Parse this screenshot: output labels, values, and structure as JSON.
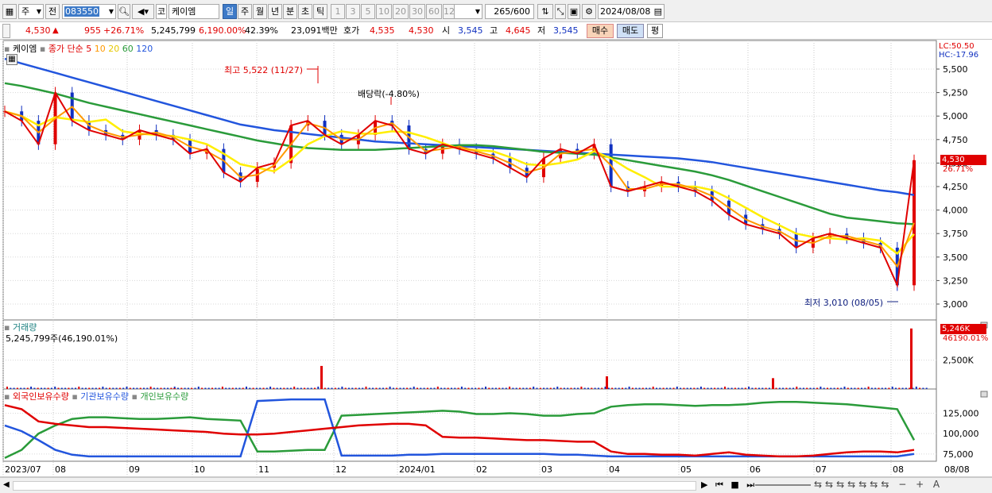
{
  "toolbar": {
    "market_mode": "주",
    "prev_label": "전",
    "stock_code": "083550",
    "market_tag": "코",
    "stock_name": "케이엠",
    "periods": [
      "일",
      "주",
      "월",
      "년",
      "분",
      "초",
      "틱"
    ],
    "active_period": "일",
    "intervals": [
      "1",
      "3",
      "5",
      "10",
      "20",
      "30",
      "60",
      "120"
    ],
    "count_value": "265",
    "count_total": "/600",
    "date": "2024/08/08"
  },
  "quote": {
    "price": "4,530",
    "change": "955",
    "change_pct": "+26.71%",
    "volume": "5,245,799",
    "volume_pct": "6,190.00%",
    "turnover": "42.39%",
    "amount": "23,091백만",
    "hoga_label": "호가",
    "ask": "4,535",
    "bid": "4,530",
    "open_label": "시",
    "open": "3,545",
    "high_label": "고",
    "high": "4,645",
    "low_label": "저",
    "low": "3,545",
    "buy_label": "매수",
    "sell_label": "매도",
    "eval_label": "평"
  },
  "price_panel": {
    "name": "케이엠",
    "legend_prefix": "종가 단순",
    "ma_labels": [
      "5",
      "10",
      "20",
      "60",
      "120"
    ],
    "ma_colors": [
      "#e00000",
      "#ff9900",
      "#ffee00",
      "#2a9b3a",
      "#2255dd"
    ],
    "lc": "LC:50.50",
    "hc": "HC:-17.96",
    "y_ticks": [
      "5,500",
      "5,250",
      "5,000",
      "4,750",
      "4,500",
      "4,250",
      "4,000",
      "3,750",
      "3,500",
      "3,250",
      "3,000"
    ],
    "current_price_tag": "4,530",
    "current_pct_tag": "26.71%",
    "high_annotation": "최고 5,522 (11/27)",
    "dividend_annotation": "배당락(-4.80%)",
    "low_annotation": "최저 3,010 (08/05)"
  },
  "volume_panel": {
    "name": "거래량",
    "info": "5,245,799주(46,190.01%)",
    "current_tag": "5,246K",
    "current_pct": "46190.01%",
    "y_tick": "2,500K"
  },
  "holding_panel": {
    "series": [
      {
        "name": "외국인보유수량",
        "color": "#e00000"
      },
      {
        "name": "기관보유수량",
        "color": "#2255dd"
      },
      {
        "name": "개인보유수량",
        "color": "#2a9b3a"
      }
    ],
    "y_ticks": [
      "125,000",
      "100,000",
      "75,000"
    ]
  },
  "x_axis": {
    "labels": [
      "2023/07",
      "08",
      "09",
      "10",
      "11",
      "12",
      "2024/01",
      "02",
      "03",
      "04",
      "05",
      "06",
      "07",
      "08"
    ],
    "right_label": "08/08"
  },
  "chart_data": {
    "type": "line",
    "price_range": [
      3000,
      5522
    ],
    "x_labels": [
      "2023/07",
      "08",
      "09",
      "10",
      "11",
      "12",
      "2024/01",
      "02",
      "03",
      "04",
      "05",
      "06",
      "07",
      "08"
    ],
    "close": [
      5050,
      4950,
      4700,
      5250,
      4950,
      4850,
      4800,
      4750,
      4850,
      4800,
      4750,
      4600,
      4650,
      4400,
      4300,
      4450,
      4500,
      4900,
      4950,
      4800,
      4700,
      4800,
      4950,
      4900,
      4650,
      4600,
      4700,
      4650,
      4600,
      4550,
      4450,
      4350,
      4550,
      4650,
      4600,
      4700,
      4250,
      4200,
      4250,
      4300,
      4250,
      4200,
      4100,
      3950,
      3850,
      3800,
      3750,
      3600,
      3700,
      3750,
      3700,
      3650,
      3600,
      3200,
      4530
    ],
    "ma120": [
      5610,
      5560,
      5510,
      5460,
      5410,
      5360,
      5310,
      5260,
      5210,
      5160,
      5110,
      5060,
      5010,
      4960,
      4910,
      4880,
      4850,
      4830,
      4810,
      4790,
      4770,
      4750,
      4730,
      4720,
      4710,
      4700,
      4690,
      4680,
      4670,
      4660,
      4650,
      4640,
      4630,
      4620,
      4610,
      4600,
      4590,
      4580,
      4570,
      4560,
      4550,
      4530,
      4510,
      4480,
      4450,
      4420,
      4390,
      4360,
      4330,
      4300,
      4270,
      4240,
      4210,
      4190,
      4160
    ],
    "ma60": [
      5350,
      5320,
      5280,
      5240,
      5190,
      5140,
      5100,
      5060,
      5020,
      4980,
      4940,
      4900,
      4860,
      4820,
      4780,
      4740,
      4710,
      4680,
      4660,
      4650,
      4640,
      4640,
      4640,
      4650,
      4660,
      4670,
      4680,
      4690,
      4690,
      4680,
      4660,
      4640,
      4620,
      4610,
      4600,
      4590,
      4560,
      4530,
      4500,
      4470,
      4440,
      4410,
      4370,
      4320,
      4260,
      4200,
      4140,
      4080,
      4020,
      3960,
      3920,
      3900,
      3880,
      3860,
      3850
    ],
    "volume_spikes": [
      {
        "x": "2023/10 초",
        "value": 60
      },
      {
        "x": "2023/11/27",
        "value": 2000
      },
      {
        "x": "2024/03/28",
        "value": 1100
      },
      {
        "x": "2024/06 중",
        "value": 940
      },
      {
        "x": "2024/08/08",
        "value": 5246
      }
    ],
    "holdings": {
      "foreign": [
        135000,
        130000,
        115000,
        112000,
        110000,
        108000,
        108000,
        107000,
        106000,
        105000,
        104000,
        103000,
        102000,
        100000,
        99000,
        99000,
        100000,
        102000,
        104000,
        106000,
        108000,
        110000,
        111000,
        112000,
        112000,
        110000,
        96000,
        95000,
        95000,
        94000,
        93000,
        92000,
        92000,
        91000,
        90000,
        90000,
        78000,
        75000,
        75000,
        74000,
        74000,
        73000,
        75000,
        77000,
        74000,
        73000,
        72000,
        72000,
        73000,
        75000,
        77000,
        78000,
        78000,
        77000,
        80000
      ],
      "institution": [
        110000,
        103000,
        92000,
        80000,
        74000,
        72000,
        72000,
        72000,
        72000,
        72000,
        72000,
        72000,
        72000,
        72000,
        72000,
        140000,
        141000,
        142000,
        142000,
        142000,
        73000,
        73000,
        73000,
        73000,
        74000,
        74000,
        75000,
        75000,
        75000,
        75000,
        75000,
        75000,
        75000,
        74000,
        74000,
        73000,
        72000,
        72000,
        72000,
        72000,
        72000,
        72000,
        72000,
        72000,
        72000,
        72000,
        72000,
        72000,
        72000,
        72000,
        72000,
        72000,
        72000,
        72000,
        75000
      ],
      "individual": [
        70000,
        80000,
        100000,
        110000,
        118000,
        120000,
        120000,
        119000,
        118000,
        118000,
        119000,
        120000,
        118000,
        117000,
        116000,
        78000,
        78000,
        79000,
        80000,
        80000,
        122000,
        123000,
        124000,
        125000,
        126000,
        127000,
        128000,
        127000,
        124000,
        124000,
        125000,
        124000,
        122000,
        122000,
        124000,
        125000,
        133000,
        135000,
        136000,
        136000,
        135000,
        134000,
        135000,
        135000,
        136000,
        138000,
        139000,
        139000,
        138000,
        137000,
        136000,
        134000,
        132000,
        130000,
        92000
      ]
    }
  }
}
